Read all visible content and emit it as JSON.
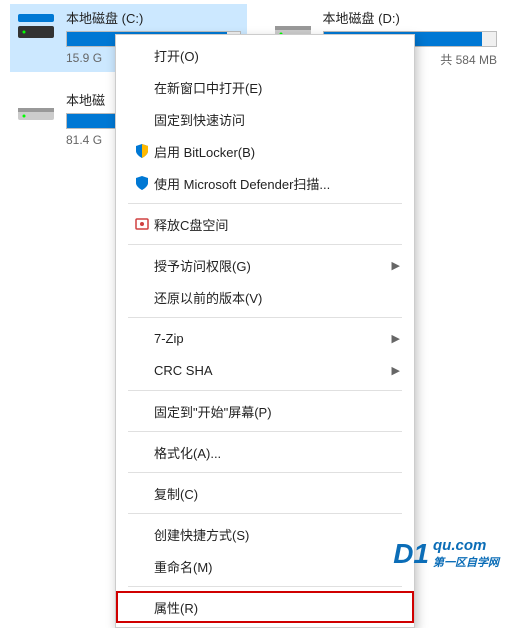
{
  "drives": [
    {
      "name": "本地磁盘 (C:)",
      "size_text": "15.9 G",
      "fill_pct": 93,
      "selected": true
    },
    {
      "name": "本地磁盘 (D:)",
      "size_text": "共 584 MB",
      "fill_pct": 92,
      "selected": false
    },
    {
      "name": "本地磁",
      "size_text": "81.4 G",
      "fill_pct": 55,
      "selected": false
    }
  ],
  "menu": {
    "items": [
      {
        "label": "打开(O)",
        "icon": null,
        "arrow": false
      },
      {
        "label": "在新窗口中打开(E)",
        "icon": null,
        "arrow": false
      },
      {
        "label": "固定到快速访问",
        "icon": null,
        "arrow": false
      },
      {
        "label": "启用 BitLocker(B)",
        "icon": "shield-blue",
        "arrow": false
      },
      {
        "label": "使用 Microsoft Defender扫描...",
        "icon": "shield-defender",
        "arrow": false
      },
      {
        "label": "释放C盘空间",
        "icon": "cleanup",
        "arrow": false,
        "sep_before": true
      },
      {
        "label": "授予访问权限(G)",
        "icon": null,
        "arrow": true,
        "sep_before": true
      },
      {
        "label": "还原以前的版本(V)",
        "icon": null,
        "arrow": false
      },
      {
        "label": "7-Zip",
        "icon": null,
        "arrow": true,
        "sep_before": true
      },
      {
        "label": "CRC SHA",
        "icon": null,
        "arrow": true
      },
      {
        "label": "固定到\"开始\"屏幕(P)",
        "icon": null,
        "arrow": false,
        "sep_before": true
      },
      {
        "label": "格式化(A)...",
        "icon": null,
        "arrow": false,
        "sep_before": true
      },
      {
        "label": "复制(C)",
        "icon": null,
        "arrow": false,
        "sep_before": true
      },
      {
        "label": "创建快捷方式(S)",
        "icon": null,
        "arrow": false,
        "sep_before": true
      },
      {
        "label": "重命名(M)",
        "icon": null,
        "arrow": false
      },
      {
        "label": "属性(R)",
        "icon": null,
        "arrow": false,
        "highlighted": true,
        "sep_before": true
      }
    ]
  },
  "watermark": {
    "logo": "D1",
    "domain": "qu.com",
    "subtitle": "第一区自学网"
  }
}
